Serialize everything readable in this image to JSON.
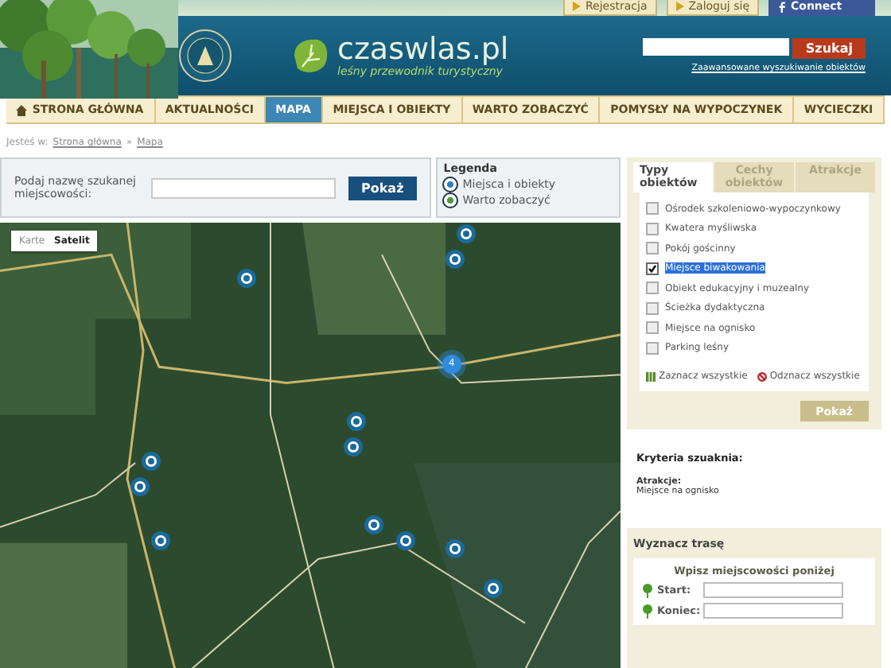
{
  "top_links": [
    {
      "label": "Rejestracja",
      "kind": "arrow"
    },
    {
      "label": "Zaloguj się",
      "kind": "arrow"
    },
    {
      "label": "Connect",
      "kind": "facebook"
    }
  ],
  "logo": {
    "name": "czaswlas.pl",
    "tagline": "leśny przewodnik turystyczny"
  },
  "header_search": {
    "button": "Szukaj",
    "link": "Zaawansowane wyszukiwanie obiektów"
  },
  "nav": [
    {
      "label": "STRONA GŁÓWNA",
      "selected": false,
      "kind": "home"
    },
    {
      "label": "AKTUALNOŚCI",
      "selected": false,
      "kind": "link"
    },
    {
      "label": "MAPA",
      "selected": true,
      "kind": "link"
    },
    {
      "label": "MIEJSCA I OBIEKTY",
      "selected": false,
      "kind": "link"
    },
    {
      "label": "WARTO ZOBACZYĆ",
      "selected": false,
      "kind": "link"
    },
    {
      "label": "POMYSŁY NA WYPOCZYNEK",
      "selected": false,
      "kind": "link"
    },
    {
      "label": "WYCIECZKI",
      "selected": false,
      "kind": "link"
    }
  ],
  "breadcrumb": {
    "prefix": "Jesteś w:",
    "items": [
      "Strona główna",
      "Mapa"
    ],
    "separator": "»"
  },
  "place_search": {
    "label": "Podaj nazwę szukanej miejscowości:",
    "button": "Pokaż"
  },
  "legend": {
    "title": "Legenda",
    "items": [
      {
        "label": "Miejsca i obiekty",
        "color": "#2a7fb8"
      },
      {
        "label": "Warto zobaczyć",
        "color": "#4a9a3a"
      }
    ]
  },
  "map": {
    "types": [
      {
        "label": "Karte",
        "selected": false
      },
      {
        "label": "Satelit",
        "selected": true
      }
    ],
    "cluster": "4"
  },
  "filter_tabs": [
    {
      "label": "Typy obiektów",
      "selected": true
    },
    {
      "label": "Cechy obiektów",
      "selected": false
    },
    {
      "label": "Atrakcje",
      "selected": false
    }
  ],
  "filters": [
    {
      "label": "Ośrodek szkoleniowo-wypoczynkowy",
      "checked": false,
      "highlighted": false
    },
    {
      "label": "Kwatera myśliwska",
      "checked": false,
      "highlighted": false
    },
    {
      "label": "Pokój gościnny",
      "checked": false,
      "highlighted": false
    },
    {
      "label": "Miejsce biwakowania",
      "checked": true,
      "highlighted": true
    },
    {
      "label": "Obiekt edukacyjny i muzealny",
      "checked": false,
      "highlighted": false
    },
    {
      "label": "Ścieżka dydaktyczna",
      "checked": false,
      "highlighted": false
    },
    {
      "label": "Miejsce na ognisko",
      "checked": false,
      "highlighted": false
    },
    {
      "label": "Parking leśny",
      "checked": false,
      "highlighted": false
    }
  ],
  "select_all": "Zaznacz wszystkie",
  "deselect_all": "Odznacz wszystkie",
  "filter_button": "Pokaż",
  "criteria": {
    "title": "Kryteria szuaknia:",
    "group": "Atrakcje:",
    "value": "Miejsce na ognisko"
  },
  "route": {
    "title": "Wyznacz trasę",
    "hint": "Wpisz miejscowości poniżej",
    "fields": [
      "Start:",
      "Koniec:"
    ]
  }
}
